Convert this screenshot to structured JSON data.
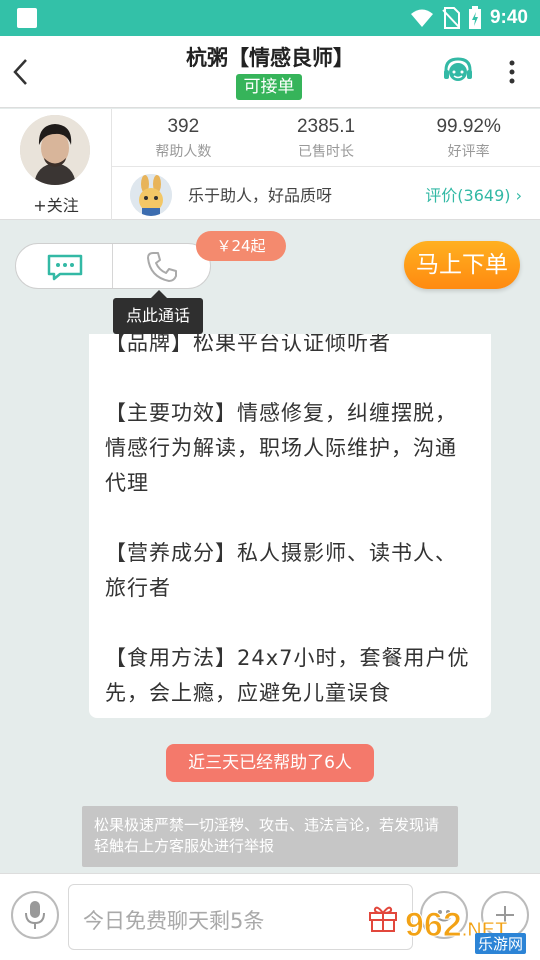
{
  "status_bar": {
    "time": "9:40"
  },
  "header": {
    "title": "杭粥【情感良师】",
    "badge": "可接单",
    "icons": {
      "back": "chevron-left-icon",
      "service": "headset-icon",
      "more": "more-vert-icon"
    }
  },
  "profile": {
    "follow_label": "+关注",
    "stats": [
      {
        "value": "392",
        "label": "帮助人数"
      },
      {
        "value": "2385.1",
        "label": "已售时长"
      },
      {
        "value": "99.92%",
        "label": "好评率"
      }
    ],
    "intro": "乐于助人，好品质呀",
    "review_link": "评价(3649) ›"
  },
  "actions": {
    "price_tag": "￥24起",
    "tooltip": "点此通话",
    "order_button": "马上下单"
  },
  "description": [
    "【品牌】松果平台认证倾听者",
    "【主要功效】情感修复，纠缠摆脱，情感行为解读，职场人际维护，沟通代理",
    "【营养成分】私人摄影师、读书人、旅行者",
    "【食用方法】24x7小时，套餐用户优先，会上瘾，应避免儿童误食"
  ],
  "helped_banner": "近三天已经帮助了6人",
  "notice": "松果极速严禁一切淫秽、攻击、违法言论，若发现请轻触右上方客服处进行举报",
  "chat": {
    "placeholder": "今日免费聊天剩5条"
  },
  "watermark": {
    "number": "962",
    "suffix": ".NET",
    "text": "乐游网"
  },
  "colors": {
    "accent": "#33c1a8",
    "order": "#ff9a18",
    "badge": "#36b45a",
    "price": "#f48a6e"
  }
}
